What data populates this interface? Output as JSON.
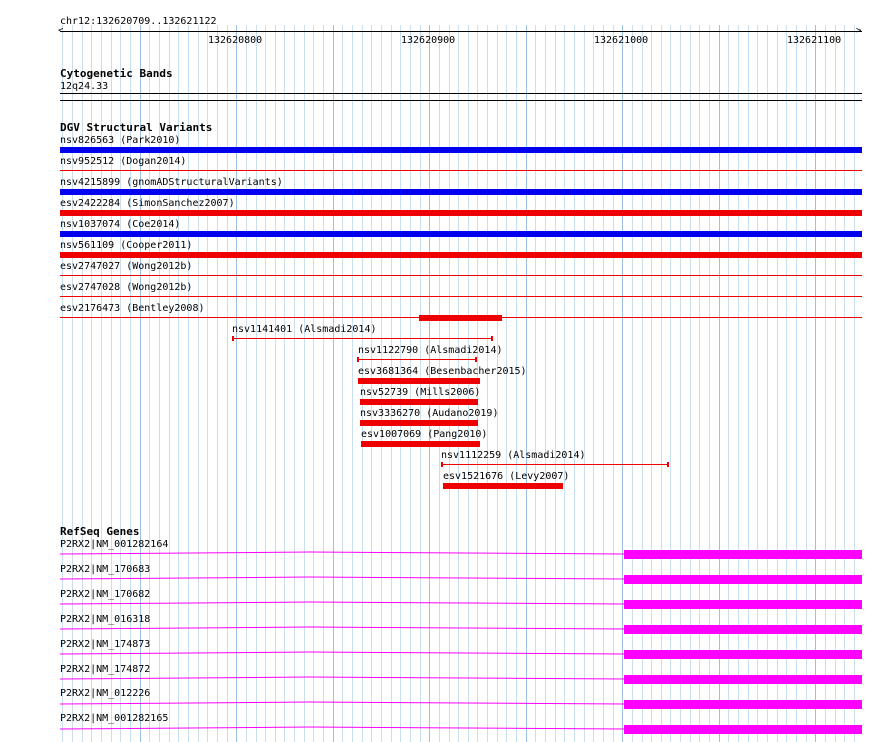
{
  "ruler": {
    "region": "chr12:132620709..132621122",
    "ticks": [
      "132620800",
      "132620900",
      "132621000",
      "132621100"
    ]
  },
  "cytobands": {
    "title": "Cytogenetic Bands",
    "band": "12q24.33"
  },
  "dgv": {
    "title": "DGV Structural Variants",
    "full_width_rows": [
      {
        "label": "nsv826563 (Park2010)",
        "color": "#0000ee"
      },
      {
        "label": "nsv952512 (Dogan2014)",
        "color": "#ee0000"
      },
      {
        "label": "nsv4215899 (gnomADStructuralVariants)",
        "color": "#0000ee"
      },
      {
        "label": "esv2422284 (SimonSanchez2007)",
        "color": "#ee0000"
      },
      {
        "label": "nsv1037074 (Coe2014)",
        "color": "#0000ee"
      },
      {
        "label": "nsv561109 (Cooper2011)",
        "color": "#ee0000"
      },
      {
        "label": "esv2747027 (Wong2012b)",
        "color": "#ee0000"
      },
      {
        "label": "esv2747028 (Wong2012b)",
        "color": "#ee0000"
      },
      {
        "label": "esv2176473 (Bentley2008)",
        "color": "#ee0000"
      }
    ],
    "partial_rows": [
      {
        "label": "nsv1141401 (Alsmadi2014)"
      },
      {
        "label": "nsv1122790 (Alsmadi2014)"
      },
      {
        "label": "esv3681364 (Besenbacher2015)"
      },
      {
        "label": "nsv52739 (Mills2006)"
      },
      {
        "label": "nsv3336270 (Audano2019)"
      },
      {
        "label": "esv1007069 (Pang2010)"
      },
      {
        "label": "nsv1112259 (Alsmadi2014)"
      },
      {
        "label": "esv1521676 (Levy2007)"
      }
    ]
  },
  "refseq": {
    "title": "RefSeq Genes",
    "genes": [
      {
        "label": "P2RX2|NM_001282164"
      },
      {
        "label": "P2RX2|NM_170683"
      },
      {
        "label": "P2RX2|NM_170682"
      },
      {
        "label": "P2RX2|NM_016318"
      },
      {
        "label": "P2RX2|NM_174873"
      },
      {
        "label": "P2RX2|NM_174872"
      },
      {
        "label": "P2RX2|NM_012226"
      },
      {
        "label": "P2RX2|NM_001282165"
      }
    ],
    "color": "#ff00ff"
  }
}
